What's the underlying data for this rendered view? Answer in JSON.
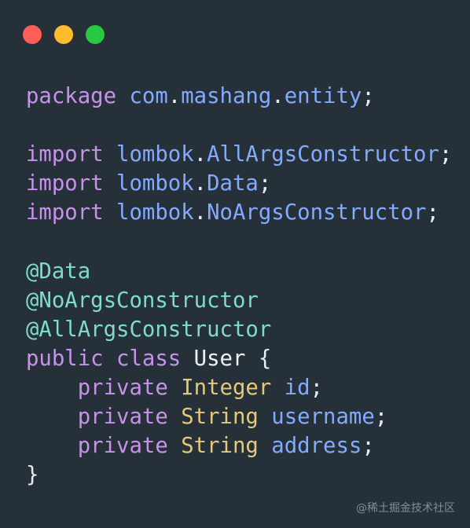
{
  "window": {
    "background": "#263038",
    "controls": [
      {
        "name": "close",
        "color": "#ff5f57"
      },
      {
        "name": "minimize",
        "color": "#febc2e"
      },
      {
        "name": "zoom",
        "color": "#28c840"
      }
    ]
  },
  "theme": {
    "keyword": "#c792ea",
    "identifier": "#82aaff",
    "punctuation": "#e6edf3",
    "annotation": "#7fdbca",
    "type": "#e6c87a",
    "plain": "#eef2f7"
  },
  "code": {
    "lines": [
      [
        {
          "text": "package",
          "kind": "keyword"
        },
        {
          "text": " ",
          "kind": "plain"
        },
        {
          "text": "com",
          "kind": "identifier"
        },
        {
          "text": ".",
          "kind": "punctuation"
        },
        {
          "text": "mashang",
          "kind": "identifier"
        },
        {
          "text": ".",
          "kind": "punctuation"
        },
        {
          "text": "entity",
          "kind": "identifier"
        },
        {
          "text": ";",
          "kind": "punctuation"
        }
      ],
      [],
      [
        {
          "text": "import",
          "kind": "keyword"
        },
        {
          "text": " ",
          "kind": "plain"
        },
        {
          "text": "lombok",
          "kind": "identifier"
        },
        {
          "text": ".",
          "kind": "punctuation"
        },
        {
          "text": "AllArgsConstructor",
          "kind": "identifier"
        },
        {
          "text": ";",
          "kind": "punctuation"
        }
      ],
      [
        {
          "text": "import",
          "kind": "keyword"
        },
        {
          "text": " ",
          "kind": "plain"
        },
        {
          "text": "lombok",
          "kind": "identifier"
        },
        {
          "text": ".",
          "kind": "punctuation"
        },
        {
          "text": "Data",
          "kind": "identifier"
        },
        {
          "text": ";",
          "kind": "punctuation"
        }
      ],
      [
        {
          "text": "import",
          "kind": "keyword"
        },
        {
          "text": " ",
          "kind": "plain"
        },
        {
          "text": "lombok",
          "kind": "identifier"
        },
        {
          "text": ".",
          "kind": "punctuation"
        },
        {
          "text": "NoArgsConstructor",
          "kind": "identifier"
        },
        {
          "text": ";",
          "kind": "punctuation"
        }
      ],
      [],
      [
        {
          "text": "@Data",
          "kind": "annotation"
        }
      ],
      [
        {
          "text": "@NoArgsConstructor",
          "kind": "annotation"
        }
      ],
      [
        {
          "text": "@AllArgsConstructor",
          "kind": "annotation"
        }
      ],
      [
        {
          "text": "public",
          "kind": "keyword"
        },
        {
          "text": " ",
          "kind": "plain"
        },
        {
          "text": "class",
          "kind": "keyword"
        },
        {
          "text": " ",
          "kind": "plain"
        },
        {
          "text": "User",
          "kind": "plain"
        },
        {
          "text": " ",
          "kind": "plain"
        },
        {
          "text": "{",
          "kind": "punctuation"
        }
      ],
      [
        {
          "text": "    ",
          "kind": "plain"
        },
        {
          "text": "private",
          "kind": "keyword"
        },
        {
          "text": " ",
          "kind": "plain"
        },
        {
          "text": "Integer",
          "kind": "type"
        },
        {
          "text": " ",
          "kind": "plain"
        },
        {
          "text": "id",
          "kind": "identifier"
        },
        {
          "text": ";",
          "kind": "punctuation"
        }
      ],
      [
        {
          "text": "    ",
          "kind": "plain"
        },
        {
          "text": "private",
          "kind": "keyword"
        },
        {
          "text": " ",
          "kind": "plain"
        },
        {
          "text": "String",
          "kind": "type"
        },
        {
          "text": " ",
          "kind": "plain"
        },
        {
          "text": "username",
          "kind": "identifier"
        },
        {
          "text": ";",
          "kind": "punctuation"
        }
      ],
      [
        {
          "text": "    ",
          "kind": "plain"
        },
        {
          "text": "private",
          "kind": "keyword"
        },
        {
          "text": " ",
          "kind": "plain"
        },
        {
          "text": "String",
          "kind": "type"
        },
        {
          "text": " ",
          "kind": "plain"
        },
        {
          "text": "address",
          "kind": "identifier"
        },
        {
          "text": ";",
          "kind": "punctuation"
        }
      ],
      [
        {
          "text": "}",
          "kind": "punctuation"
        }
      ]
    ]
  },
  "watermark": {
    "text": "@稀土掘金技术社区"
  }
}
